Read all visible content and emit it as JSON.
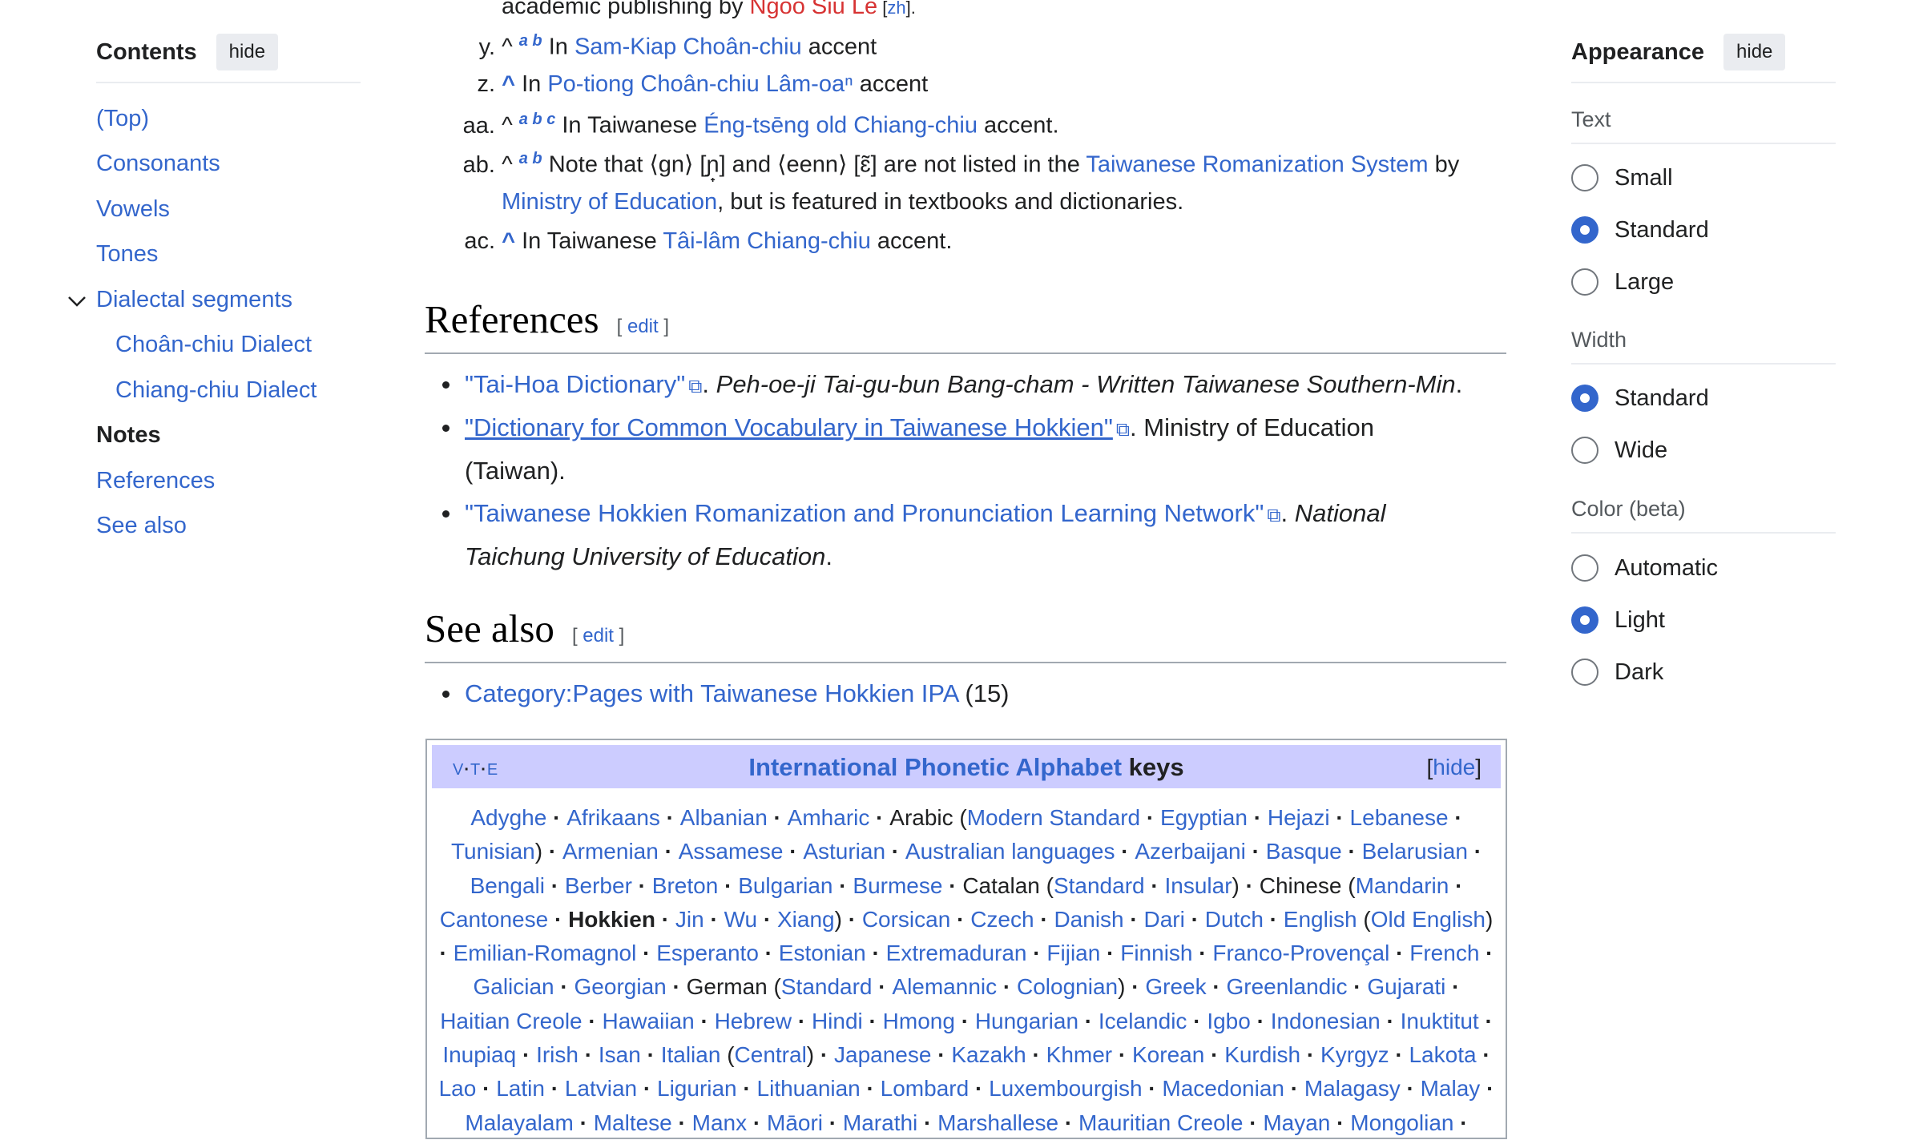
{
  "toc": {
    "title": "Contents",
    "hide": "hide",
    "items": [
      {
        "label": "(Top)"
      },
      {
        "label": "Consonants"
      },
      {
        "label": "Vowels"
      },
      {
        "label": "Tones"
      },
      {
        "label": "Dialectal segments"
      },
      {
        "label": "Choân-chiu Dialect"
      },
      {
        "label": "Chiang-chiu Dialect"
      },
      {
        "label": "Notes"
      },
      {
        "label": "References"
      },
      {
        "label": "See also"
      }
    ]
  },
  "appearance": {
    "title": "Appearance",
    "hide": "hide",
    "text_label": "Text",
    "text_options": [
      "Small",
      "Standard",
      "Large"
    ],
    "text_selected": "Standard",
    "width_label": "Width",
    "width_options": [
      "Standard",
      "Wide"
    ],
    "width_selected": "Standard",
    "color_label": "Color (beta)",
    "color_options": [
      "Automatic",
      "Light",
      "Dark"
    ],
    "color_selected": "Light"
  },
  "notes": {
    "x_tail_1": "academic publishing by ",
    "x_tail_link": "Ngoo Siu Le",
    "x_tail_lang": "zh",
    "y": {
      "label": "y.",
      "backrefs": "a b",
      "pre": "In ",
      "link": "Sam-Kiap Choân-chiu",
      "post": " accent"
    },
    "z": {
      "label": "z.",
      "pre": "In ",
      "link": "Po-tiong Choân-chiu Lâm-oaⁿ",
      "post": " accent"
    },
    "aa": {
      "label": "aa.",
      "backrefs": "a b c",
      "pre": "In Taiwanese ",
      "link": "Éng-tsēng old Chiang-chiu",
      "post": " accent."
    },
    "ab": {
      "label": "ab.",
      "backrefs": "a b",
      "pre": "Note that ⟨gn⟩ [ɲ̟] and ⟨eenn⟩ [ɛ̃] are not listed in the ",
      "link": "Taiwanese Romanization System",
      "post": " by",
      "link2": "Ministry of Education",
      "post2": ", but is featured in textbooks and dictionaries."
    },
    "ac": {
      "label": "ac.",
      "pre": "In Taiwanese ",
      "link": "Tâi-lâm Chiang-chiu",
      "post": " accent."
    }
  },
  "references": {
    "heading": "References",
    "edit": "edit",
    "items": [
      {
        "link": "\"Tai-Hoa Dictionary\"",
        "rest": "Peh-oe-ji Tai-gu-bun Bang-cham - Written Taiwanese Southern-Min"
      },
      {
        "link": "\"Dictionary for Common Vocabulary in Taiwanese Hokkien\"",
        "rest": "Ministry of Education",
        "rest2": "(Taiwan)."
      },
      {
        "link": "\"Taiwanese Hokkien Romanization and Pronunciation Learning Network\"",
        "rest": "National",
        "rest2": "Taichung University of Education"
      }
    ]
  },
  "see_also": {
    "heading": "See also",
    "edit": "edit",
    "item_link": "Category:Pages with Taiwanese Hokkien IPA",
    "item_count": "(15)"
  },
  "navbox": {
    "vte": [
      "V",
      "T",
      "E"
    ],
    "title_link": "International Phonetic Alphabet",
    "title_rest": " keys",
    "hide": "hide",
    "lines": [
      [
        [
          "l",
          "Adyghe"
        ],
        [
          "s"
        ],
        [
          "l",
          "Afrikaans"
        ],
        [
          "s"
        ],
        [
          "l",
          "Albanian"
        ],
        [
          "s"
        ],
        [
          "l",
          "Amharic"
        ],
        [
          "s"
        ],
        [
          "t",
          "Arabic ("
        ],
        [
          "l",
          "Modern Standard"
        ],
        [
          "s"
        ],
        [
          "l",
          "Egyptian"
        ],
        [
          "s"
        ],
        [
          "l",
          "Hejazi"
        ],
        [
          "s"
        ],
        [
          "l",
          "Lebanese"
        ],
        [
          "s"
        ]
      ],
      [
        [
          "l",
          "Tunisian"
        ],
        [
          "t",
          ")"
        ],
        [
          "s"
        ],
        [
          "l",
          "Armenian"
        ],
        [
          "s"
        ],
        [
          "l",
          "Assamese"
        ],
        [
          "s"
        ],
        [
          "l",
          "Asturian"
        ],
        [
          "s"
        ],
        [
          "l",
          "Australian languages"
        ],
        [
          "s"
        ],
        [
          "l",
          "Azerbaijani"
        ],
        [
          "s"
        ],
        [
          "l",
          "Basque"
        ],
        [
          "s"
        ],
        [
          "l",
          "Belarusian"
        ],
        [
          "s"
        ]
      ],
      [
        [
          "l",
          "Bengali"
        ],
        [
          "s"
        ],
        [
          "l",
          "Berber"
        ],
        [
          "s"
        ],
        [
          "l",
          "Breton"
        ],
        [
          "s"
        ],
        [
          "l",
          "Bulgarian"
        ],
        [
          "s"
        ],
        [
          "l",
          "Burmese"
        ],
        [
          "s"
        ],
        [
          "t",
          "Catalan ("
        ],
        [
          "l",
          "Standard"
        ],
        [
          "s"
        ],
        [
          "l",
          "Insular"
        ],
        [
          "t",
          ")"
        ],
        [
          "s"
        ],
        [
          "t",
          "Chinese ("
        ],
        [
          "l",
          "Mandarin"
        ],
        [
          "s"
        ]
      ],
      [
        [
          "l",
          "Cantonese"
        ],
        [
          "s"
        ],
        [
          "b",
          "Hokkien"
        ],
        [
          "s"
        ],
        [
          "l",
          "Jin"
        ],
        [
          "s"
        ],
        [
          "l",
          "Wu"
        ],
        [
          "s"
        ],
        [
          "l",
          "Xiang"
        ],
        [
          "t",
          ")"
        ],
        [
          "s"
        ],
        [
          "l",
          "Corsican"
        ],
        [
          "s"
        ],
        [
          "l",
          "Czech"
        ],
        [
          "s"
        ],
        [
          "l",
          "Danish"
        ],
        [
          "s"
        ],
        [
          "l",
          "Dari"
        ],
        [
          "s"
        ],
        [
          "l",
          "Dutch"
        ],
        [
          "s"
        ],
        [
          "l",
          "English"
        ],
        [
          "t",
          " ("
        ],
        [
          "l",
          "Old English"
        ],
        [
          "t",
          ")"
        ]
      ],
      [
        [
          "s"
        ],
        [
          "l",
          "Emilian-Romagnol"
        ],
        [
          "s"
        ],
        [
          "l",
          "Esperanto"
        ],
        [
          "s"
        ],
        [
          "l",
          "Estonian"
        ],
        [
          "s"
        ],
        [
          "l",
          "Extremaduran"
        ],
        [
          "s"
        ],
        [
          "l",
          "Fijian"
        ],
        [
          "s"
        ],
        [
          "l",
          "Finnish"
        ],
        [
          "s"
        ],
        [
          "l",
          "Franco-Provençal"
        ],
        [
          "s"
        ],
        [
          "l",
          "French"
        ],
        [
          "s"
        ]
      ],
      [
        [
          "l",
          "Galician"
        ],
        [
          "s"
        ],
        [
          "l",
          "Georgian"
        ],
        [
          "s"
        ],
        [
          "t",
          "German ("
        ],
        [
          "l",
          "Standard"
        ],
        [
          "s"
        ],
        [
          "l",
          "Alemannic"
        ],
        [
          "s"
        ],
        [
          "l",
          "Colognian"
        ],
        [
          "t",
          ")"
        ],
        [
          "s"
        ],
        [
          "l",
          "Greek"
        ],
        [
          "s"
        ],
        [
          "l",
          "Greenlandic"
        ],
        [
          "s"
        ],
        [
          "l",
          "Gujarati"
        ],
        [
          "s"
        ]
      ],
      [
        [
          "l",
          "Haitian Creole"
        ],
        [
          "s"
        ],
        [
          "l",
          "Hawaiian"
        ],
        [
          "s"
        ],
        [
          "l",
          "Hebrew"
        ],
        [
          "s"
        ],
        [
          "l",
          "Hindi"
        ],
        [
          "s"
        ],
        [
          "l",
          "Hmong"
        ],
        [
          "s"
        ],
        [
          "l",
          "Hungarian"
        ],
        [
          "s"
        ],
        [
          "l",
          "Icelandic"
        ],
        [
          "s"
        ],
        [
          "l",
          "Igbo"
        ],
        [
          "s"
        ],
        [
          "l",
          "Indonesian"
        ],
        [
          "s"
        ],
        [
          "l",
          "Inuktitut"
        ],
        [
          "s"
        ]
      ],
      [
        [
          "l",
          "Inupiaq"
        ],
        [
          "s"
        ],
        [
          "l",
          "Irish"
        ],
        [
          "s"
        ],
        [
          "l",
          "Isan"
        ],
        [
          "s"
        ],
        [
          "l",
          "Italian"
        ],
        [
          "t",
          " ("
        ],
        [
          "l",
          "Central"
        ],
        [
          "t",
          ")"
        ],
        [
          "s"
        ],
        [
          "l",
          "Japanese"
        ],
        [
          "s"
        ],
        [
          "l",
          "Kazakh"
        ],
        [
          "s"
        ],
        [
          "l",
          "Khmer"
        ],
        [
          "s"
        ],
        [
          "l",
          "Korean"
        ],
        [
          "s"
        ],
        [
          "l",
          "Kurdish"
        ],
        [
          "s"
        ],
        [
          "l",
          "Kyrgyz"
        ],
        [
          "s"
        ],
        [
          "l",
          "Lakota"
        ],
        [
          "s"
        ]
      ],
      [
        [
          "l",
          "Lao"
        ],
        [
          "s"
        ],
        [
          "l",
          "Latin"
        ],
        [
          "s"
        ],
        [
          "l",
          "Latvian"
        ],
        [
          "s"
        ],
        [
          "l",
          "Ligurian"
        ],
        [
          "s"
        ],
        [
          "l",
          "Lithuanian"
        ],
        [
          "s"
        ],
        [
          "l",
          "Lombard"
        ],
        [
          "s"
        ],
        [
          "l",
          "Luxembourgish"
        ],
        [
          "s"
        ],
        [
          "l",
          "Macedonian"
        ],
        [
          "s"
        ],
        [
          "l",
          "Malagasy"
        ],
        [
          "s"
        ],
        [
          "l",
          "Malay"
        ],
        [
          "s"
        ]
      ],
      [
        [
          "l",
          "Malayalam"
        ],
        [
          "s"
        ],
        [
          "l",
          "Maltese"
        ],
        [
          "s"
        ],
        [
          "l",
          "Manx"
        ],
        [
          "s"
        ],
        [
          "l",
          "Māori"
        ],
        [
          "s"
        ],
        [
          "l",
          "Marathi"
        ],
        [
          "s"
        ],
        [
          "l",
          "Marshallese"
        ],
        [
          "s"
        ],
        [
          "l",
          "Mauritian Creole"
        ],
        [
          "s"
        ],
        [
          "l",
          "Mayan"
        ],
        [
          "s"
        ],
        [
          "l",
          "Mongolian"
        ],
        [
          "s"
        ]
      ]
    ]
  }
}
